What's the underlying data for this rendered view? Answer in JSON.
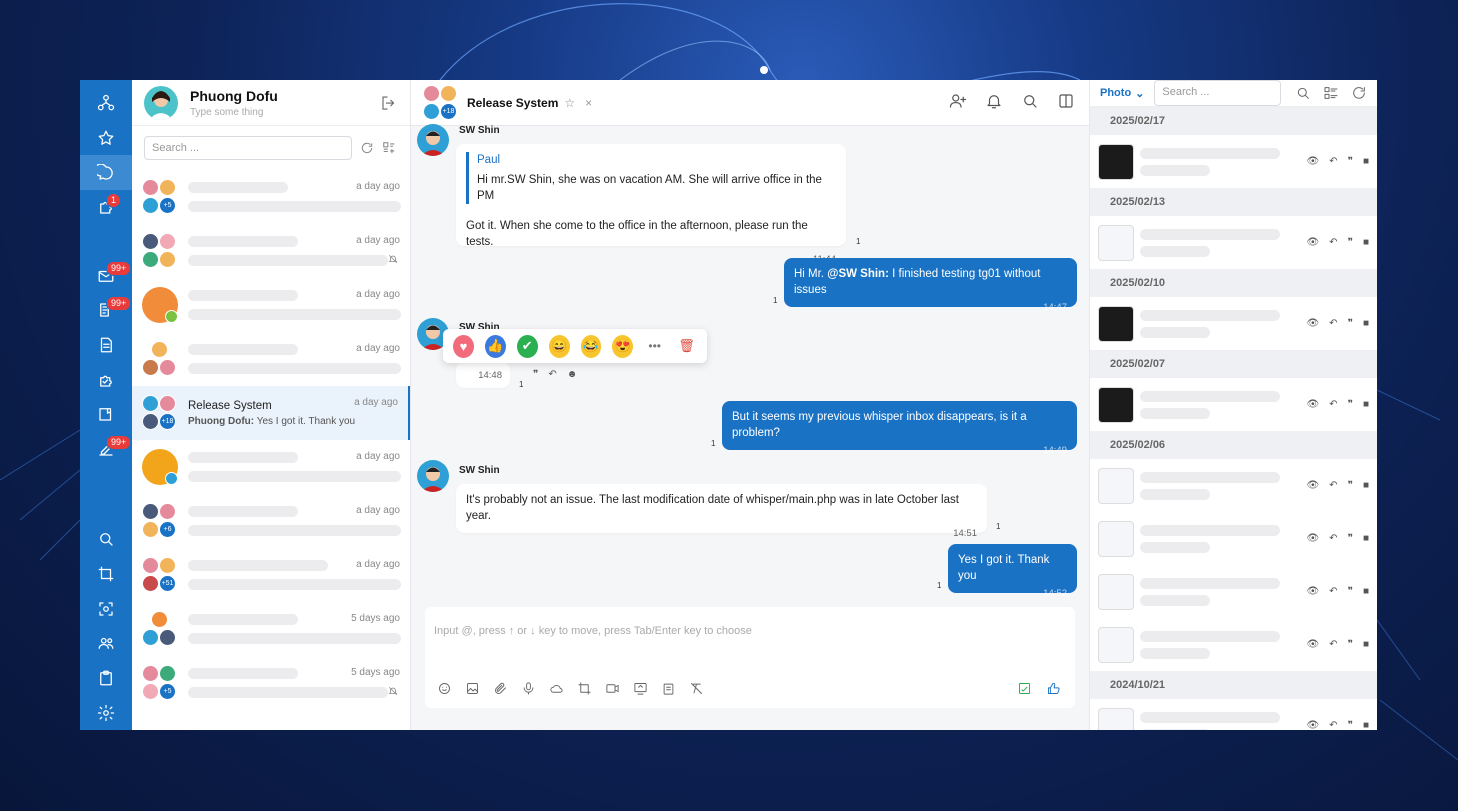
{
  "profile": {
    "name": "Phuong Dofu",
    "status": "Type some thing"
  },
  "rail": {
    "badges": {
      "mention": "1",
      "mail": "99+",
      "notes": "99+",
      "tasks": "99+"
    }
  },
  "list": {
    "search_placeholder": "Search ...",
    "items": [
      {
        "time": "a day ago",
        "count": "+5"
      },
      {
        "time": "a day ago"
      },
      {
        "time": "a day ago"
      },
      {
        "time": "a day ago"
      },
      {
        "time": "a day ago",
        "name": "Release System",
        "preview_sender": "Phuong Dofu:",
        "preview_text": " Yes I got it. Thank you",
        "count": "+18"
      },
      {
        "time": "a day ago"
      },
      {
        "time": "a day ago",
        "count": "+6"
      },
      {
        "time": "a day ago",
        "count": "+51"
      },
      {
        "time": "5 days ago"
      },
      {
        "time": "5 days ago",
        "count": "+5"
      }
    ]
  },
  "chat": {
    "title": "Release System",
    "member_count": "+18",
    "messages": [
      {
        "sender": "SW Shin",
        "quote_name": "Paul",
        "quote_text": "Hi mr.SW Shin, she was on vacation AM. She will arrive office in the PM",
        "text": "Got it. When she come to the office in the afternoon, please run the tests.",
        "time": "11:44",
        "read": "1"
      },
      {
        "mention_prefix": "Hi Mr. ",
        "mention": "@SW Shin:",
        "text": " I finished testing tg01 without issues",
        "time": "14:47",
        "read": "1"
      },
      {
        "sender": "SW Shin",
        "time": "14:48",
        "read": "1"
      },
      {
        "text": "But it seems my previous whisper inbox disappears, is it a problem?",
        "time": "14:49",
        "read": "1"
      },
      {
        "sender": "SW Shin",
        "text": "It's probably not an issue. The last modification date of whisper/main.php was in late October last year.",
        "time": "14:51",
        "read": "1"
      },
      {
        "text": "Yes I got it. Thank you",
        "time": "14:52",
        "read": "1"
      }
    ],
    "reactions": [
      "heart",
      "thumbs-up",
      "check",
      "grin",
      "laugh",
      "heart-eyes",
      "more",
      "delete"
    ],
    "composer_placeholder": "Input @, press ↑ or ↓ key to move, press Tab/Enter key to choose"
  },
  "files": {
    "filter": "Photo",
    "search_placeholder": "Search ...",
    "groups": [
      {
        "date": "2025/02/17",
        "count": 1
      },
      {
        "date": "2025/02/13",
        "count": 1
      },
      {
        "date": "2025/02/10",
        "count": 1
      },
      {
        "date": "2025/02/07",
        "count": 1
      },
      {
        "date": "2025/02/06",
        "count": 4
      },
      {
        "date": "2024/10/21",
        "count": 1
      }
    ]
  },
  "colors": {
    "brand": "#1a72c4",
    "badge": "#ea3b3b"
  }
}
